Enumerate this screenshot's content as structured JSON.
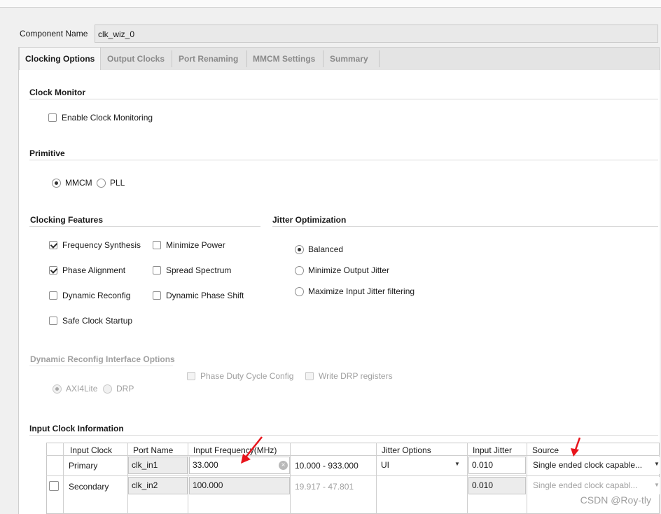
{
  "component": {
    "label": "Component Name",
    "value": "clk_wiz_0"
  },
  "tabs": [
    {
      "label": "Clocking Options",
      "active": true
    },
    {
      "label": "Output Clocks",
      "active": false
    },
    {
      "label": "Port Renaming",
      "active": false
    },
    {
      "label": "MMCM Settings",
      "active": false
    },
    {
      "label": "Summary",
      "active": false
    }
  ],
  "clock_monitor": {
    "title": "Clock Monitor",
    "enable_label": "Enable Clock Monitoring",
    "enabled": false
  },
  "primitive": {
    "title": "Primitive",
    "options": [
      "MMCM",
      "PLL"
    ],
    "selected": "MMCM"
  },
  "clocking_features": {
    "title": "Clocking Features",
    "frequency_synthesis": "Frequency Synthesis",
    "minimize_power": "Minimize Power",
    "phase_alignment": "Phase Alignment",
    "spread_spectrum": "Spread Spectrum",
    "dynamic_reconfig": "Dynamic Reconfig",
    "dynamic_phase_shift": "Dynamic Phase Shift",
    "safe_clock_startup": "Safe Clock Startup"
  },
  "jitter_optimization": {
    "title": "Jitter Optimization",
    "options": [
      "Balanced",
      "Minimize Output Jitter",
      "Maximize Input Jitter filtering"
    ],
    "selected": "Balanced"
  },
  "dynamic_reconfig_interface": {
    "title": "Dynamic Reconfig Interface Options",
    "phase_duty_cycle": "Phase Duty Cycle Config",
    "write_drp": "Write DRP registers",
    "axi4lite": "AXI4Lite",
    "drp": "DRP"
  },
  "input_clock": {
    "title": "Input Clock Information",
    "headers": [
      "Input Clock",
      "Port Name",
      "Input Frequency(MHz)",
      "",
      "Jitter Options",
      "Input Jitter",
      "Source"
    ],
    "rows": [
      {
        "name": "Primary",
        "port": "clk_in1",
        "freq": "33.000",
        "range": "10.000 - 933.000",
        "jitter_option": "UI",
        "jitter": "0.010",
        "source": "Single ended clock capable..."
      },
      {
        "name": "Secondary",
        "port": "clk_in2",
        "freq": "100.000",
        "range": "19.917 - 47.801",
        "jitter_option": "",
        "jitter": "0.010",
        "source": "Single ended clock capabl..."
      }
    ]
  },
  "watermark": "CSDN @Roy-tly",
  "colors": {
    "annotation_arrow": "#e8141c"
  }
}
